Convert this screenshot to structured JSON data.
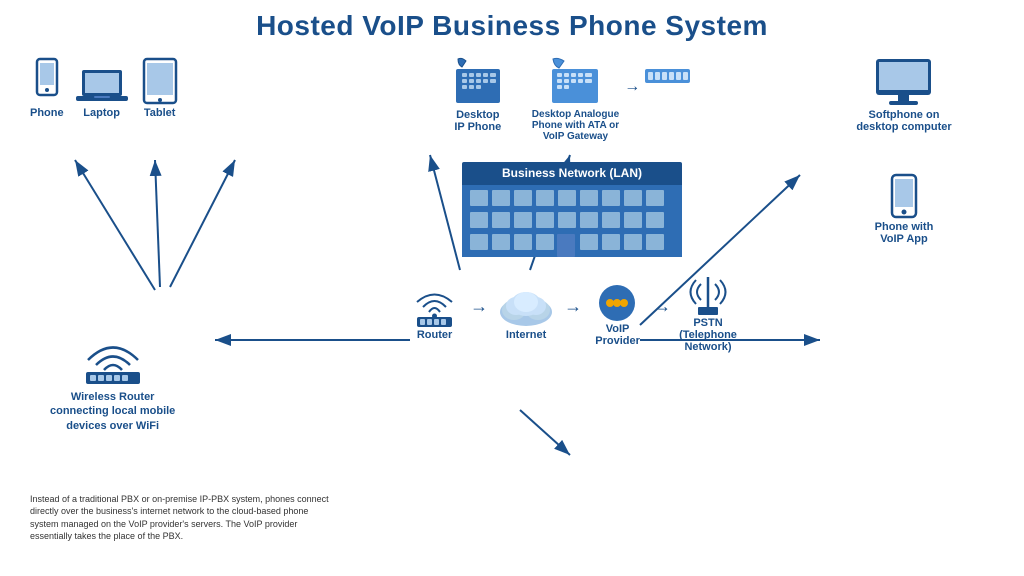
{
  "title": "Hosted VoIP Business Phone System",
  "devices": {
    "left_top": [
      {
        "id": "phone",
        "label": "Phone"
      },
      {
        "id": "laptop",
        "label": "Laptop"
      },
      {
        "id": "tablet",
        "label": "Tablet"
      }
    ],
    "center_top": [
      {
        "id": "desktop_ip",
        "label": "Desktop\nIP Phone"
      },
      {
        "id": "desktop_analogue",
        "label": "Desktop Analogue\nPhone with ATA or\nVoIP Gateway"
      }
    ],
    "right_top": [
      {
        "id": "softphone",
        "label": "Softphone on\ndesktop computer"
      }
    ],
    "right_mid": [
      {
        "id": "phone_voip",
        "label": "Phone with\nVoIP App"
      }
    ]
  },
  "wireless_router": {
    "label": "Wireless Router\nconnecting local mobile\ndevices over WiFi"
  },
  "business_network": {
    "label": "Business Network (LAN)"
  },
  "bottom_items": [
    {
      "id": "router",
      "label": "Router"
    },
    {
      "id": "internet",
      "label": "Internet"
    },
    {
      "id": "voip_provider",
      "label": "VoIP\nProvider"
    },
    {
      "id": "pstn",
      "label": "PSTN\n(Telephone\nNetwork)"
    }
  ],
  "info_text": "Instead of a traditional PBX or on-premise IP-PBX system, phones connect directly over the business's internet network to the cloud-based phone system managed on the VoIP provider's servers. The VoIP provider essentially takes the place of the PBX.",
  "colors": {
    "blue": "#1a4f8a",
    "light_blue": "#4a90d9",
    "mid_blue": "#2e6db4"
  }
}
